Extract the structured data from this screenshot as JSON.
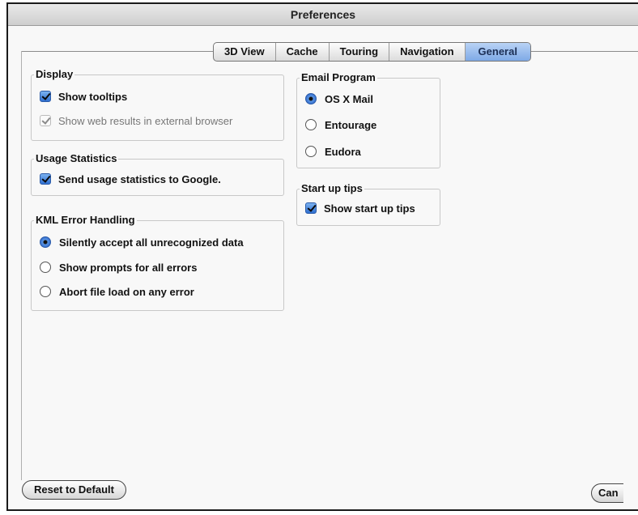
{
  "window": {
    "title": "Preferences"
  },
  "tabs": [
    {
      "label": "3D View",
      "active": false
    },
    {
      "label": "Cache",
      "active": false
    },
    {
      "label": "Touring",
      "active": false
    },
    {
      "label": "Navigation",
      "active": false
    },
    {
      "label": "General",
      "active": true
    }
  ],
  "display": {
    "title": "Display",
    "show_tooltips": {
      "label": "Show tooltips",
      "checked": true
    },
    "show_web_results": {
      "label": "Show web results in external browser",
      "checked": true,
      "enabled": false
    }
  },
  "usage": {
    "title": "Usage Statistics",
    "send_stats": {
      "label": "Send usage statistics to Google.",
      "checked": true
    }
  },
  "kml": {
    "title": "KML Error Handling",
    "options": [
      {
        "label": "Silently accept all unrecognized data",
        "selected": true
      },
      {
        "label": "Show prompts for all errors",
        "selected": false
      },
      {
        "label": "Abort file load on any error",
        "selected": false
      }
    ]
  },
  "email": {
    "title": "Email Program",
    "options": [
      {
        "label": "OS X Mail",
        "selected": true
      },
      {
        "label": "Entourage",
        "selected": false
      },
      {
        "label": "Eudora",
        "selected": false
      }
    ]
  },
  "startup": {
    "title": "Start up tips",
    "show_tips": {
      "label": "Show start up tips",
      "checked": true
    }
  },
  "buttons": {
    "reset": "Reset to Default",
    "cancel": "Can"
  },
  "colors": {
    "accent": "#2f6fd0",
    "active_tab": "#7ea9e6"
  }
}
